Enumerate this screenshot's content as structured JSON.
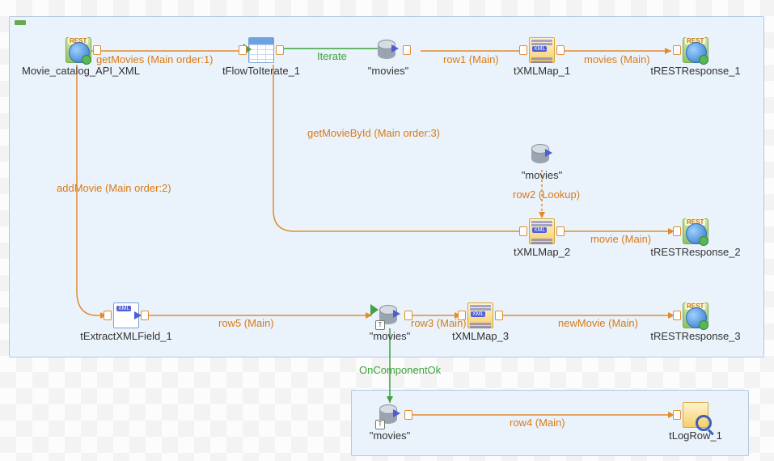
{
  "nodes": {
    "movie_catalog_api_xml": {
      "label": "Movie_catalog_API_XML"
    },
    "tflowtoiterate_1": {
      "label": "tFlowToIterate_1"
    },
    "movies_1": {
      "label": "\"movies\""
    },
    "txmlmap_1": {
      "label": "tXMLMap_1"
    },
    "trestresponse_1": {
      "label": "tRESTResponse_1"
    },
    "movies_2": {
      "label": "\"movies\""
    },
    "txmlmap_2": {
      "label": "tXMLMap_2"
    },
    "trestresponse_2": {
      "label": "tRESTResponse_2"
    },
    "textractxmlfield_1": {
      "label": "tExtractXMLField_1"
    },
    "movies_3": {
      "label": "\"movies\""
    },
    "txmlmap_3": {
      "label": "tXMLMap_3"
    },
    "trestresponse_3": {
      "label": "tRESTResponse_3"
    },
    "movies_4": {
      "label": "\"movies\""
    },
    "tlogrow_1": {
      "label": "tLogRow_1"
    }
  },
  "links": {
    "getmovies": "getMovies (Main order:1)",
    "iterate": "Iterate",
    "row1": "row1 (Main)",
    "movies_link": "movies (Main)",
    "getmoviebyid": "getMovieById (Main order:3)",
    "row2": "row2 (Lookup)",
    "movie_link": "movie (Main)",
    "addmovie": "addMovie (Main order:2)",
    "row5": "row5 (Main)",
    "row3": "row3 (Main)",
    "newmovie": "newMovie (Main)",
    "oncomponentok": "OnComponentOk",
    "row4": "row4 (Main)"
  },
  "colors": {
    "orange": "#d97b17",
    "green": "#3aa23a",
    "subjob_bg": "#eaf2fb",
    "subjob_border": "#b3c8e0"
  }
}
